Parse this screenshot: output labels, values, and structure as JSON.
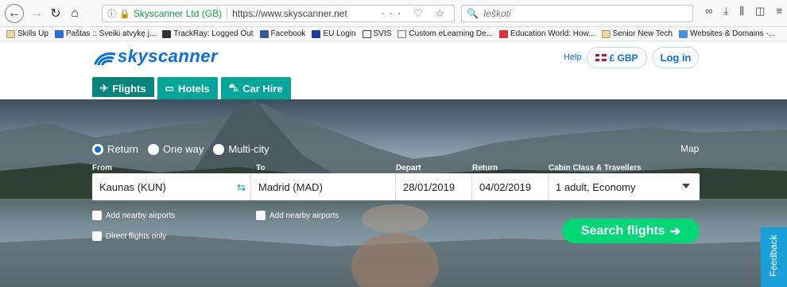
{
  "browser": {
    "site_name": "Skyscanner Ltd (GB)",
    "url": "https://www.skyscanner.net",
    "search_placeholder": "Ieškoti",
    "bookmarks": [
      {
        "label": "Skills Up",
        "icon": "folder-icon"
      },
      {
        "label": "Paštas :: Sveiki atvykę j...",
        "icon": "mail-icon"
      },
      {
        "label": "TrackRay: Logged Out",
        "icon": "trackray-icon"
      },
      {
        "label": "Facebook",
        "icon": "facebook-icon"
      },
      {
        "label": "EU Login",
        "icon": "eu-icon"
      },
      {
        "label": "SVIS",
        "icon": "globe-icon"
      },
      {
        "label": "Custom eLearning De...",
        "icon": "swirl-icon"
      },
      {
        "label": "Education World: How...",
        "icon": "ew-icon"
      },
      {
        "label": "Senior New Tech",
        "icon": "folder-icon"
      },
      {
        "label": "Websites & Domains -...",
        "icon": "wix-icon"
      }
    ]
  },
  "header": {
    "logo": "skyscanner",
    "help": "Help",
    "currency": "£ GBP",
    "login": "Log in"
  },
  "tabs": [
    {
      "label": "Flights",
      "icon": "plane-icon",
      "active": true
    },
    {
      "label": "Hotels",
      "icon": "bed-icon",
      "active": false
    },
    {
      "label": "Car Hire",
      "icon": "car-icon",
      "active": false
    }
  ],
  "search": {
    "trip_types": [
      "Return",
      "One way",
      "Multi-city"
    ],
    "selected_trip": "Return",
    "map": "Map",
    "labels": {
      "from": "From",
      "to": "To",
      "depart": "Depart",
      "return": "Return",
      "cabin": "Cabin Class & Travellers"
    },
    "from": "Kaunas (KUN)",
    "to": "Madrid (MAD)",
    "depart": "28/01/2019",
    "return": "04/02/2019",
    "cabin": "1 adult, Economy",
    "nearby_from": "Add nearby airports",
    "nearby_to": "Add nearby airports",
    "direct": "Direct flights only",
    "button": "Search flights"
  },
  "feedback": "Feedback",
  "colors": {
    "brand_blue": "#0770e3",
    "tab_teal": "#00a698",
    "search_green": "#00d775",
    "feedback_blue": "#1aa0d8"
  }
}
